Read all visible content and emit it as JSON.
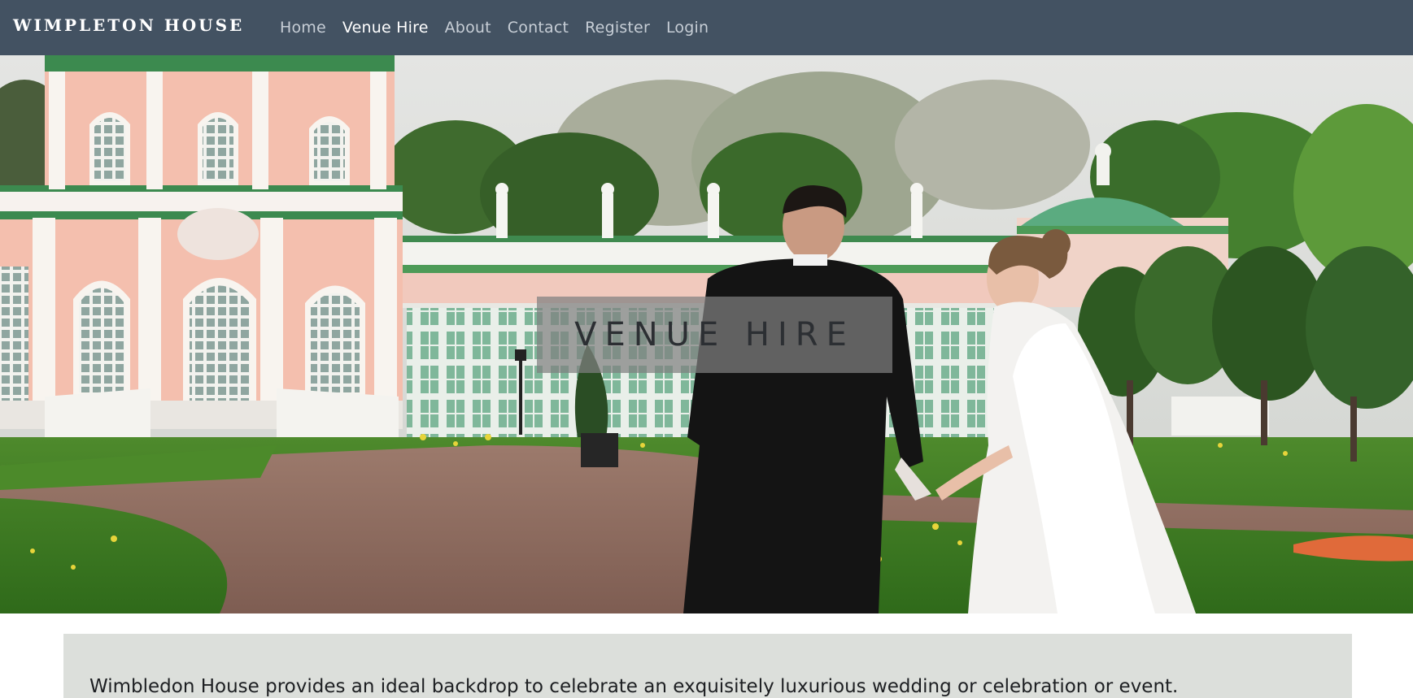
{
  "navbar": {
    "brand": "WIMPLETON HOUSE",
    "links": [
      {
        "label": "Home",
        "active": false
      },
      {
        "label": "Venue Hire",
        "active": true
      },
      {
        "label": "About",
        "active": false
      },
      {
        "label": "Contact",
        "active": false
      },
      {
        "label": "Register",
        "active": false
      },
      {
        "label": "Login",
        "active": false
      }
    ]
  },
  "hero": {
    "title": "VENUE HIRE"
  },
  "intro": {
    "text": "Wimbledon House provides an ideal backdrop to celebrate an exquisitely luxurious wedding or celebration or event."
  },
  "colors": {
    "navbar_bg": "#435262",
    "nav_link": "#c7ced6",
    "nav_link_active": "#ffffff",
    "intro_bg": "#dcdfdb"
  }
}
